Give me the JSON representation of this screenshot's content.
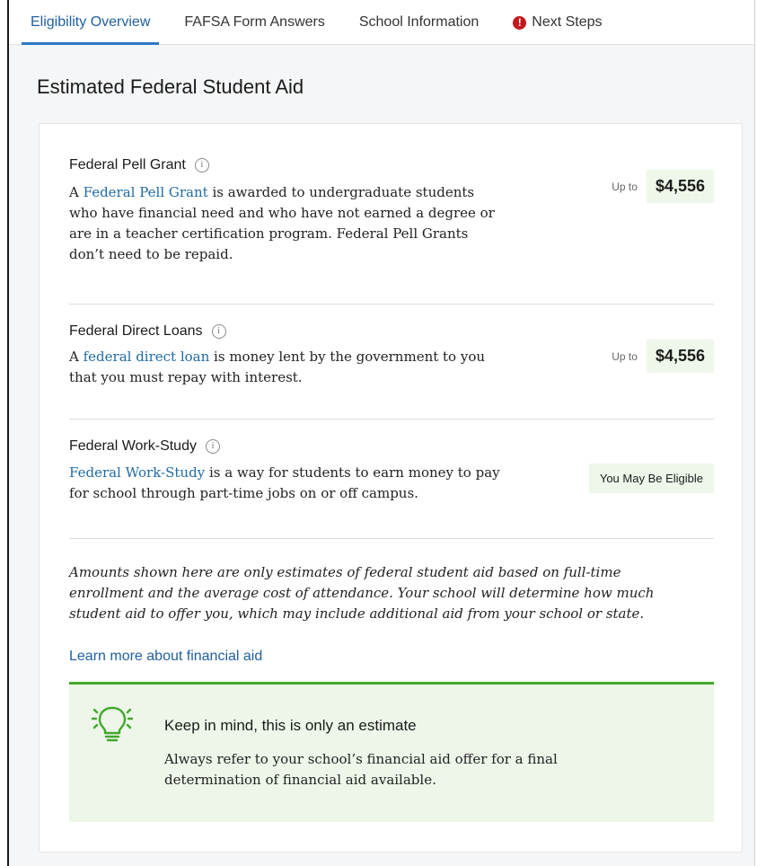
{
  "tabs": [
    {
      "label": "Eligibility Overview",
      "active": true
    },
    {
      "label": "FAFSA Form Answers",
      "active": false
    },
    {
      "label": "School Information",
      "active": false
    },
    {
      "label": "Next Steps",
      "active": false,
      "alert": true
    }
  ],
  "section_title": "Estimated Federal Student Aid",
  "aid_items": [
    {
      "title": "Federal Pell Grant",
      "link_text": "Federal Pell Grant",
      "desc_prefix": "A ",
      "desc_suffix": " is awarded to undergraduate students who have financial need and who have not earned a degree or are in a teacher certification program. Federal Pell Grants don’t need to be repaid.",
      "upto_label": "Up to",
      "amount": "$4,556"
    },
    {
      "title": "Federal Direct Loans",
      "link_text": "federal direct loan",
      "desc_prefix": "A ",
      "desc_suffix": " is money lent by the government to you that you must repay with interest.",
      "upto_label": "Up to",
      "amount": "$4,556"
    },
    {
      "title": "Federal Work-Study",
      "link_text": "Federal Work-Study",
      "desc_prefix": "",
      "desc_suffix": " is a way for students to earn money to pay for school through part-time jobs on or off campus.",
      "eligibility": "You May Be Eligible"
    }
  ],
  "disclaimer": "Amounts shown here are only estimates of federal student aid based on full-time enrollment and the average cost of attendance. Your school will determine how much student aid to offer you, which may include additional aid from your school or state.",
  "learn_more": "Learn more about financial aid",
  "estimate_notice": {
    "title": "Keep in mind, this is only an estimate",
    "text": "Always refer to your school’s financial aid offer for a final determination of financial aid available.",
    "icon": "lightbulb-icon"
  },
  "info_icon_glyph": "i",
  "alert_icon_glyph": "!",
  "colors": {
    "accent": "#2e78c2",
    "link": "#1f6aa5",
    "alert": "#c4161c",
    "success_border": "#43a82c",
    "success_bg": "#edf6e9"
  }
}
